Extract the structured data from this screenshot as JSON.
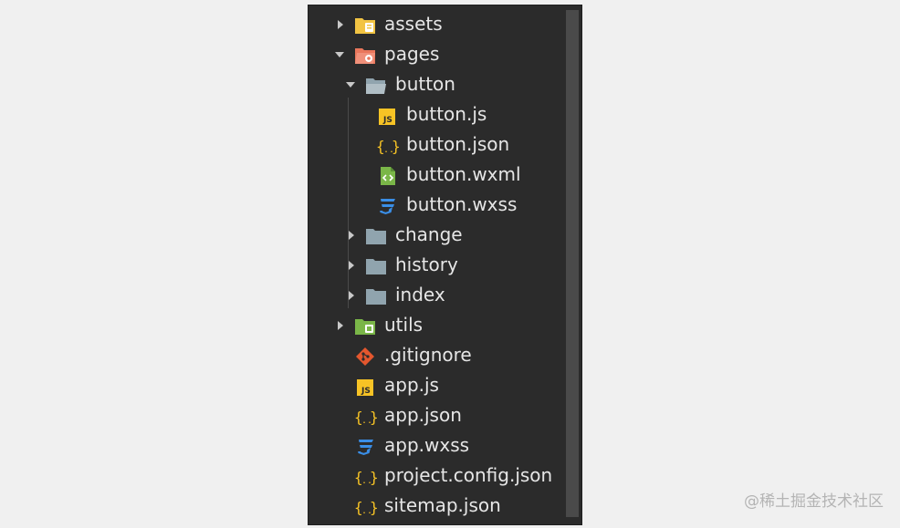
{
  "explorer": {
    "items": [
      {
        "label": "assets",
        "icon": "folder-assets-icon",
        "color": "#f2c443",
        "state": "collapsed"
      },
      {
        "label": "pages",
        "icon": "folder-pages-icon",
        "color": "#e9775c",
        "state": "expanded"
      },
      {
        "label": "button",
        "icon": "folder-open-icon",
        "color": "#90a4ae",
        "state": "expanded"
      },
      {
        "label": "button.js",
        "icon": "js-file-icon",
        "color": "#f7c325"
      },
      {
        "label": "button.json",
        "icon": "json-file-icon",
        "color": "#f7c325"
      },
      {
        "label": "button.wxml",
        "icon": "wxml-file-icon",
        "color": "#7ab648"
      },
      {
        "label": "button.wxss",
        "icon": "css-file-icon",
        "color": "#3a8ee6"
      },
      {
        "label": "change",
        "icon": "folder-icon",
        "color": "#90a4ae",
        "state": "collapsed"
      },
      {
        "label": "history",
        "icon": "folder-icon",
        "color": "#90a4ae",
        "state": "collapsed"
      },
      {
        "label": "index",
        "icon": "folder-icon",
        "color": "#90a4ae",
        "state": "collapsed"
      },
      {
        "label": "utils",
        "icon": "folder-utils-icon",
        "color": "#7ab648",
        "state": "collapsed"
      },
      {
        "label": ".gitignore",
        "icon": "git-file-icon",
        "color": "#e4572e"
      },
      {
        "label": "app.js",
        "icon": "js-file-icon",
        "color": "#f7c325"
      },
      {
        "label": "app.json",
        "icon": "json-file-icon",
        "color": "#f7c325"
      },
      {
        "label": "app.wxss",
        "icon": "css-file-icon",
        "color": "#3a8ee6"
      },
      {
        "label": "project.config.json",
        "icon": "json-file-icon",
        "color": "#f7c325"
      },
      {
        "label": "sitemap.json",
        "icon": "json-file-icon",
        "color": "#f7c325"
      }
    ]
  },
  "watermark": "@稀土掘金技术社区"
}
